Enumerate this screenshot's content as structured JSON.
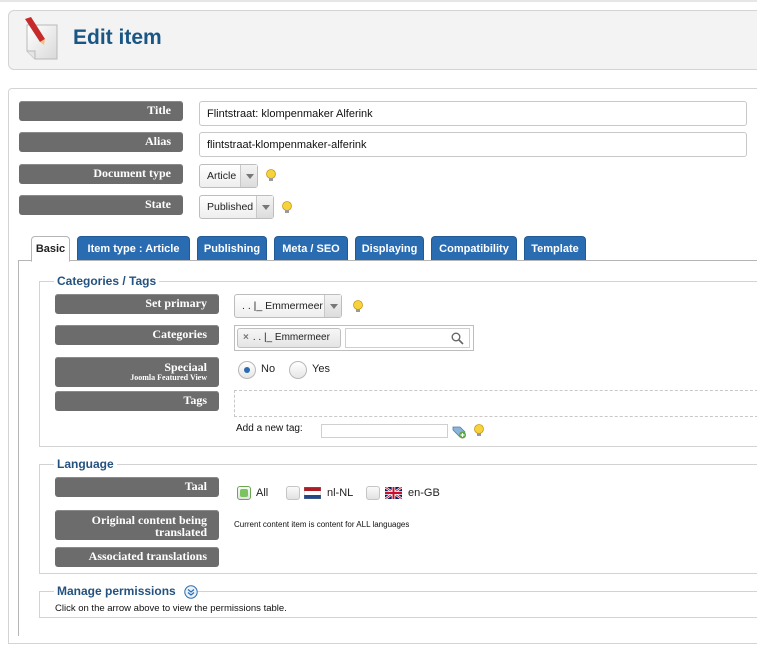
{
  "header": {
    "title": "Edit item"
  },
  "fields": {
    "title": {
      "label": "Title",
      "value": "Flintstraat: klompenmaker Alferink"
    },
    "alias": {
      "label": "Alias",
      "value": "flintstraat-klompenmaker-alferink"
    },
    "doctype": {
      "label": "Document type",
      "value": "Article"
    },
    "state": {
      "label": "State",
      "value": "Published"
    }
  },
  "tabs": [
    {
      "label": "Basic"
    },
    {
      "label": "Item type : Article"
    },
    {
      "label": "Publishing"
    },
    {
      "label": "Meta / SEO"
    },
    {
      "label": "Displaying"
    },
    {
      "label": "Compatibility"
    },
    {
      "label": "Template"
    }
  ],
  "categories": {
    "legend": "Categories / Tags",
    "set_primary": {
      "label": "Set primary",
      "value": ". . |_ Emmermeer"
    },
    "categories": {
      "label": "Categories",
      "chip": ". . |_ Emmermeer",
      "chip_remove": "×"
    },
    "featured": {
      "label": "Speciaal",
      "sublabel": "Joomla Featured View",
      "no": "No",
      "yes": "Yes",
      "selected": "No"
    },
    "tags": {
      "label": "Tags",
      "add_label": "Add a new tag:"
    }
  },
  "language": {
    "legend": "Language",
    "taal": {
      "label": "Taal",
      "options": [
        "All",
        "nl-NL",
        "en-GB"
      ],
      "selected": "All"
    },
    "original": {
      "label": "Original content being translated",
      "note": "Current content item is content for ALL languages"
    },
    "associated": {
      "label": "Associated translations"
    }
  },
  "permissions": {
    "legend": "Manage permissions",
    "note": "Click on the arrow above to view the permissions table."
  },
  "colors": {
    "tab": "#2a6cb2",
    "label_bg": "#6c6c6c",
    "legend": "#24527f",
    "title": "#1a5684"
  }
}
